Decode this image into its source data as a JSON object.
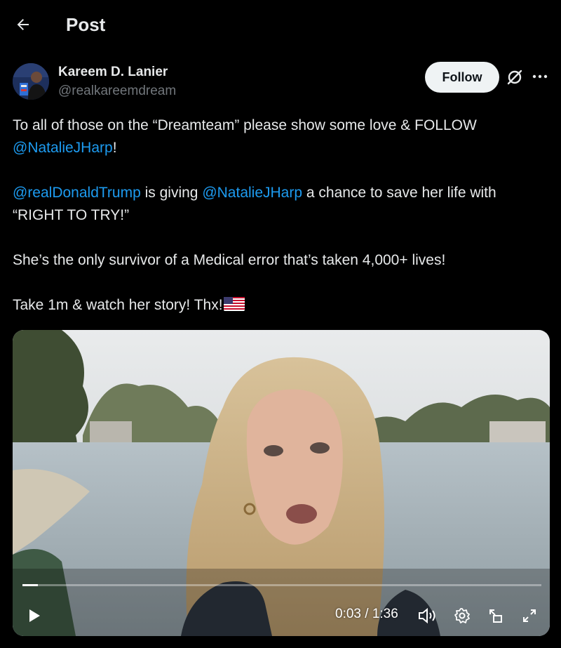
{
  "header": {
    "back_icon": "arrow-left-icon",
    "title": "Post"
  },
  "author": {
    "name": "Kareem D. Lanier",
    "handle": "@realkareemdream",
    "follow_label": "Follow",
    "grok_icon": "grok-icon",
    "more_icon": "more-horizontal-icon"
  },
  "post": {
    "line1": "To all of those on the “Dreamteam” please show some love & FOLLOW",
    "line1_mention": "@NatalieJHarp",
    "line1_end": "!",
    "p2_mention1": "@realDonaldTrump",
    "p2_text1": " is giving ",
    "p2_mention2": "@NatalieJHarp",
    "p2_text2": " a chance to save her life with “RIGHT TO TRY!”",
    "p3": "She’s the only survivor of a Medical error that’s taken 4,000+ lives!",
    "p4": "Take 1m & watch her story! Thx!",
    "flag_icon": "us-flag-icon"
  },
  "video": {
    "current_time": "0:03",
    "separator": " / ",
    "duration": "1:36",
    "progress": 0.03,
    "play_icon": "play-icon",
    "volume_icon": "volume-icon",
    "settings_icon": "gear-icon",
    "pip_icon": "picture-in-picture-icon",
    "fullscreen_icon": "fullscreen-icon"
  },
  "colors": {
    "background": "#000000",
    "text": "#e7e9ea",
    "secondary": "#71767b",
    "link": "#1d9bf0",
    "follow_bg": "#eff3f4"
  }
}
